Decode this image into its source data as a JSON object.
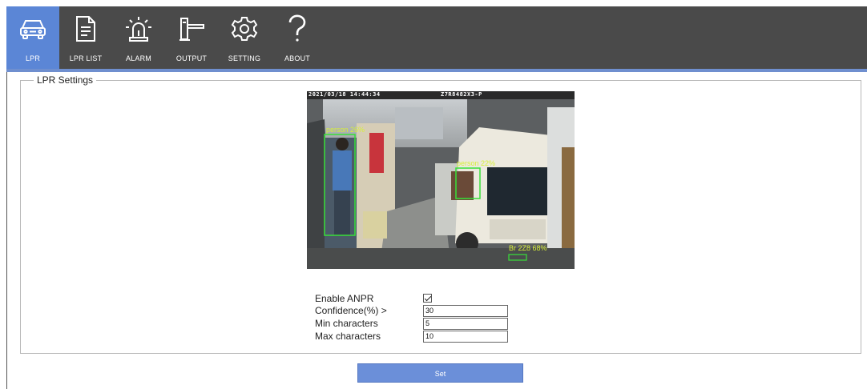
{
  "toolbar": {
    "items": [
      {
        "label": "LPR",
        "icon": "car-icon",
        "active": true
      },
      {
        "label": "LPR LIST",
        "icon": "document-list-icon",
        "active": false
      },
      {
        "label": "ALARM",
        "icon": "alarm-siren-icon",
        "active": false
      },
      {
        "label": "OUTPUT",
        "icon": "barrier-gate-icon",
        "active": false
      },
      {
        "label": "SETTING",
        "icon": "gear-icon",
        "active": false
      },
      {
        "label": "ABOUT",
        "icon": "question-mark-icon",
        "active": false
      }
    ]
  },
  "colors": {
    "toolbar_bg": "#4a4a4a",
    "active": "#5b86d6",
    "button": "#6b8fd9"
  },
  "settings": {
    "legend": "LPR Settings",
    "camera": {
      "osd_time": "2021/03/18 14:44:34",
      "osd_id": "Z7R8482X3-P",
      "detections": [
        {
          "label": "person 26%"
        },
        {
          "label": "person 22%"
        },
        {
          "label": "Br 2Z8 68%"
        }
      ]
    },
    "enable_anpr": {
      "label": "Enable ANPR",
      "checked": true
    },
    "confidence": {
      "label": "Confidence(%) >",
      "value": "30"
    },
    "min_chars": {
      "label": "Min characters",
      "value": "5"
    },
    "max_chars": {
      "label": "Max characters",
      "value": "10"
    }
  },
  "actions": {
    "set_label": "Set"
  }
}
